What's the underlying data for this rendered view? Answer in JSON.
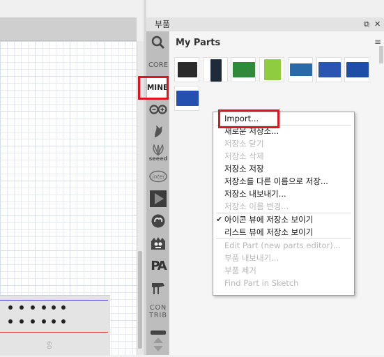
{
  "panel": {
    "title": "부품",
    "float_icon": "restore-icon",
    "close_icon": "close-icon"
  },
  "bins": [
    {
      "name": "search-bin",
      "label": "",
      "icon": "magnifier-icon"
    },
    {
      "name": "core-bin",
      "label": "CORE"
    },
    {
      "name": "mine-bin",
      "label": "MINE"
    },
    {
      "name": "arduino-bin",
      "label": "",
      "icon": "arduino-icon"
    },
    {
      "name": "sparkfun-bin",
      "label": "",
      "icon": "sparkfun-flame-icon"
    },
    {
      "name": "seeed-bin",
      "label": "seeed",
      "icon": "seeed-icon"
    },
    {
      "name": "intel-bin",
      "label": "intel",
      "icon": "intel-icon"
    },
    {
      "name": "play-bin",
      "label": "",
      "icon": "play-icon"
    },
    {
      "name": "snootlab-bin",
      "label": "",
      "icon": "snootlab-icon"
    },
    {
      "name": "lilypad-bin",
      "label": "",
      "icon": "monster-icon"
    },
    {
      "name": "pa-bin",
      "label": "PA"
    },
    {
      "name": "piano-bin",
      "label": "",
      "icon": "piano-icon"
    },
    {
      "name": "contrib-bin",
      "label": "CONTRIB"
    }
  ],
  "content": {
    "heading": "My Parts",
    "menu_button": "≡",
    "parts": [
      {
        "name": "part-1",
        "color": "#222222"
      },
      {
        "name": "part-2",
        "color": "#1d2b3a"
      },
      {
        "name": "part-3",
        "color": "#2f8a3a"
      },
      {
        "name": "part-4",
        "color": "#8fcc3f"
      },
      {
        "name": "part-5",
        "color": "#2a6aa8"
      },
      {
        "name": "part-6",
        "color": "#2a55b0"
      },
      {
        "name": "part-7",
        "color": "#1f4ea8"
      },
      {
        "name": "part-8",
        "color": "#1f4aa8"
      },
      {
        "name": "part-9",
        "color": "#2450b0"
      }
    ]
  },
  "menu": {
    "import": "Import...",
    "new_bin": "새로운 저장소...",
    "close_bin": "저장소 닫기",
    "delete_bin": "저장소 삭제",
    "save_bin": "저장소 저장",
    "save_bin_as": "저장소를 다른 이름으로 저장...",
    "export_bin": "저장소 내보내기...",
    "rename_bin": "저장소 이름 변경...",
    "icon_view": "아이콘 뷰에 저장소 보이기",
    "list_view": "리스트 뷰에 저장소 보이기",
    "edit_part": "Edit Part (new parts editor)...",
    "export_part": "부품 내보내기...",
    "remove_part": "부품 제거",
    "find_part": "Find Part in Sketch"
  },
  "canvas": {
    "breadboard_label": "60"
  }
}
